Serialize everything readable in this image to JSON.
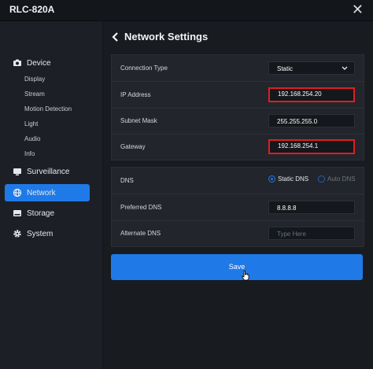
{
  "window": {
    "title": "RLC-820A",
    "close_glyph": "✕"
  },
  "sidebar": {
    "device": {
      "label": "Device",
      "icon": "camera-icon",
      "subitems": [
        "Display",
        "Stream",
        "Motion Detection",
        "Light",
        "Audio",
        "Info"
      ]
    },
    "items": [
      {
        "label": "Surveillance",
        "icon": "monitor-icon"
      },
      {
        "label": "Network",
        "icon": "globe-icon",
        "active": true
      },
      {
        "label": "Storage",
        "icon": "storage-icon"
      },
      {
        "label": "System",
        "icon": "gear-icon"
      }
    ]
  },
  "header": {
    "back_glyph": "‹",
    "title": "Network Settings"
  },
  "connection": {
    "type_label": "Connection Type",
    "type_value": "Static",
    "ip_label": "IP Address",
    "ip_value": "192.168.254.20",
    "mask_label": "Subnet Mask",
    "mask_value": "255.255.255.0",
    "gateway_label": "Gateway",
    "gateway_value": "192.168.254.1"
  },
  "dns": {
    "label": "DNS",
    "static_label": "Static DNS",
    "auto_label": "Auto DNS",
    "selected": "static",
    "preferred_label": "Preferred DNS",
    "preferred_value": "8.8.8.8",
    "alternate_label": "Alternate DNS",
    "alternate_placeholder": "Type Here"
  },
  "actions": {
    "save_label": "Save"
  },
  "colors": {
    "accent": "#1f7ae8",
    "highlight": "#e21d1d"
  }
}
